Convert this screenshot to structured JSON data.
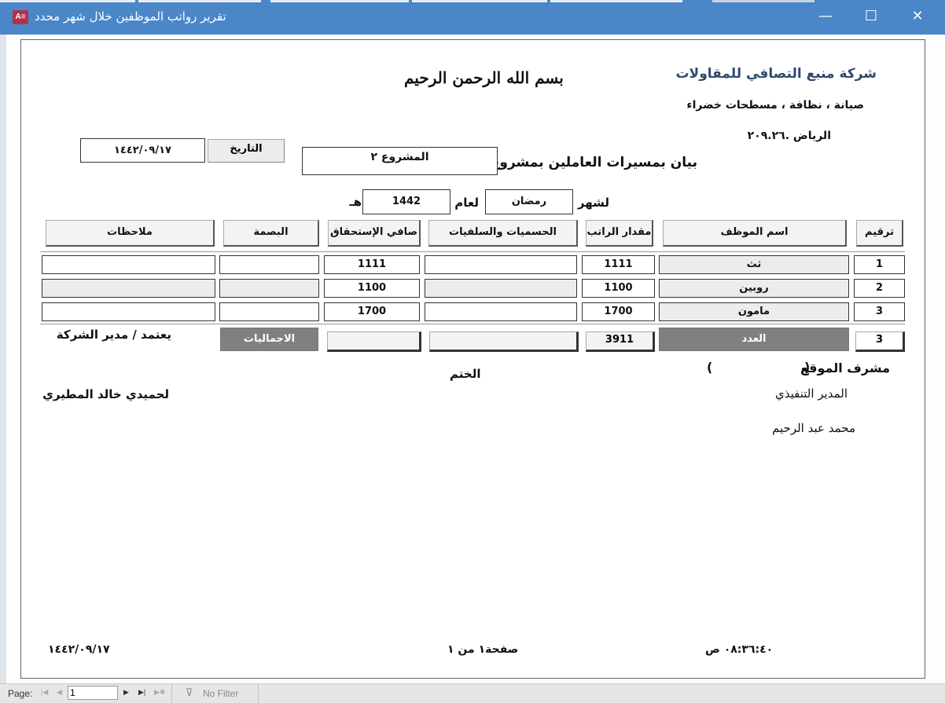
{
  "window": {
    "title": "تقرير رواتب الموظفين خلال شهر محدد",
    "app_icon_text": "A≡",
    "minimize": "—",
    "maximize": "☐",
    "close": "✕"
  },
  "header": {
    "company_name": "شركة منبع التصافي للمقاولات",
    "services": "صيانة ، نظافة ، مسطحات خضراء",
    "city_line": "الرياض .٢٠٩.٢٦",
    "basmala": "بسم الله الرحمن الرحيم",
    "date_label": "التاريخ",
    "date_value": "١٤٤٢/٠٩/١٧"
  },
  "statement": {
    "label": "بيان بمسيرات العاملين بمشروع",
    "project": "المشروع ٢",
    "month_label": "لشهر",
    "month": "رمضان",
    "year_label": "لعام",
    "year": "1442",
    "hijri": "هـ"
  },
  "table": {
    "columns": [
      "ترقيم",
      "اسم الموظف",
      "مقدار الراتب",
      "الحسميات والسلفيات",
      "صافي الإستحقاق",
      "البصمة",
      "ملاحظات"
    ],
    "rows": [
      {
        "num": "1",
        "name": "ثث",
        "salary": "1111",
        "deductions": "",
        "net": "1111",
        "fingerprint": "",
        "notes": ""
      },
      {
        "num": "2",
        "name": "روبين",
        "salary": "1100",
        "deductions": "",
        "net": "1100",
        "fingerprint": "",
        "notes": ""
      },
      {
        "num": "3",
        "name": "مامون",
        "salary": "1700",
        "deductions": "",
        "net": "1700",
        "fingerprint": "",
        "notes": ""
      }
    ],
    "totals": {
      "count": "3",
      "count_label": "العدد",
      "salary_total": "3911",
      "deductions_total": "",
      "net_total": "",
      "totals_label": "الاجماليات"
    }
  },
  "signatures": {
    "approve_label": "يعتمد / مدير الشركة",
    "manager_name": "لحميدي خالد المطيري",
    "stamp_label": "الختم",
    "site_supervisor": "مشرف الموقع",
    "paren_open": "(",
    "paren_close": ")",
    "exec_manager_label": "المدير التنفيذي",
    "exec_manager_name": "محمد عبد الرحيم"
  },
  "footer": {
    "date": "١٤٤٢/٠٩/١٧",
    "page": "صفحة١ من ١",
    "time": "٠٨:٣٦:٤٠ ص"
  },
  "statusbar": {
    "page_label": "Page:",
    "page_value": "1",
    "first": "|◀",
    "prev": "◀",
    "next": "▶",
    "last": "▶|",
    "new": "▶✱",
    "filter_label": "No Filter"
  },
  "colors": {
    "titlebar": "#4a86c8",
    "dark_cell": "#808080",
    "company": "#2e4a6e"
  }
}
